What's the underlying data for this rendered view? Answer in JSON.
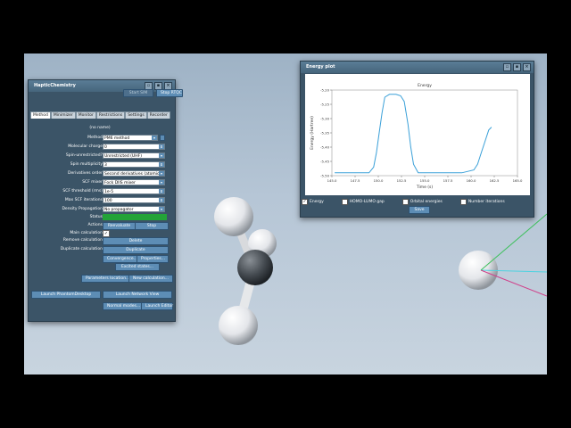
{
  "hc": {
    "title": "HapticChemistry",
    "btn_start_sim": "Start SIM",
    "btn_stop_rtqc": "Stop RTQC",
    "tabs": [
      "Method",
      "Minimizer",
      "Monitor",
      "Restrictions",
      "Settings",
      "Recorder"
    ],
    "name": "(no name)",
    "fields": [
      {
        "label": "Method",
        "value": "PM6 method"
      },
      {
        "label": "Molecular charge",
        "value": "0"
      },
      {
        "label": "Spin-unrestricted?",
        "value": "Unrestricted (UHF)"
      },
      {
        "label": "Spin multiplicity",
        "value": "3"
      },
      {
        "label": "Derivatives order",
        "value": "Second derivatives (atomic)"
      },
      {
        "label": "SCF mixer",
        "value": "Fock DIIS mixer"
      },
      {
        "label": "SCF threshold (rms)",
        "value": "1e-5"
      },
      {
        "label": "Max SCF iterations",
        "value": "100"
      },
      {
        "label": "Density Propagation",
        "value": "No propagator"
      }
    ],
    "status_label": "Status",
    "actions_label": "Actions",
    "btn_reevaluate": "Reevaluate",
    "btn_stop": "Stop",
    "main_calc_label": "Main calculation",
    "remove_calc_label": "Remove calculation",
    "btn_delete": "Delete",
    "duplicate_calc_label": "Duplicate calculation",
    "btn_duplicate": "Duplicate",
    "btn_convergence": "Convergence...",
    "btn_properties": "Properties...",
    "btn_excited": "Excited states...",
    "btn_param_location": "Parameters location...",
    "btn_new_calc": "New calculation...",
    "btn_launch_phantom": "Launch PhantomDesktop",
    "btn_launch_network": "Launch Network View",
    "btn_normal_modes": "Normal modes...",
    "btn_launch_editor": "Launch Editor"
  },
  "ep": {
    "title": "Energy plot",
    "legend": [
      {
        "label": "Energy",
        "checked": true
      },
      {
        "label": "HOMO-LUMO gap",
        "checked": false
      },
      {
        "label": "Orbital energies",
        "checked": false
      },
      {
        "label": "Number iterations",
        "checked": false
      }
    ],
    "btn_save": "Save"
  },
  "chart_data": {
    "type": "line",
    "title": "Energy",
    "xlabel": "Time (s)",
    "ylabel": "Energy (Hartree)",
    "xlim": [
      145.0,
      165.0
    ],
    "ylim": [
      -5.5,
      -5.2
    ],
    "xticks": [
      "145.0",
      "147.5",
      "150.0",
      "152.5",
      "155.0",
      "157.5",
      "160.0",
      "162.5",
      "165.0"
    ],
    "yticks": [
      "-5.20",
      "-5.25",
      "-5.30",
      "-5.35",
      "-5.40",
      "-5.45",
      "-5.50"
    ],
    "color": "#3aa0d8",
    "series": [
      {
        "x": [
          145.3,
          146.5,
          148.0,
          149.0,
          149.5,
          149.8,
          150.1,
          150.4,
          150.7,
          151.2,
          151.9,
          152.4,
          152.8,
          153.2,
          153.5,
          153.8,
          154.3,
          155.0,
          157.0,
          159.0,
          160.3,
          160.7,
          161.1,
          161.5,
          161.9,
          162.2
        ],
        "y": [
          -5.49,
          -5.49,
          -5.49,
          -5.49,
          -5.47,
          -5.42,
          -5.35,
          -5.28,
          -5.225,
          -5.215,
          -5.215,
          -5.22,
          -5.24,
          -5.32,
          -5.4,
          -5.46,
          -5.49,
          -5.49,
          -5.49,
          -5.49,
          -5.48,
          -5.46,
          -5.42,
          -5.38,
          -5.34,
          -5.33
        ]
      }
    ]
  }
}
